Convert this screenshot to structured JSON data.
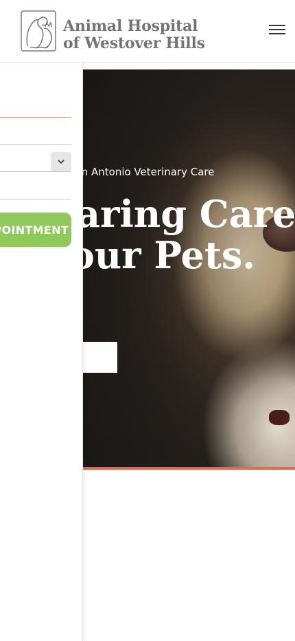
{
  "header": {
    "logo_line1": "Animal Hospital",
    "logo_line2": "of Westover Hills",
    "menu_icon": "hamburger-menu-icon"
  },
  "hero": {
    "kicker": "San Antonio Veterinary Care",
    "title_line1": "Caring Care for",
    "title_line2": "Your Pets.",
    "accent_color": "#e06b4e"
  },
  "drawer": {
    "appointment_button": "REQUEST APPOINTMENT",
    "button_color": "#8ec95a",
    "select_icon": "chevron-down-icon"
  }
}
